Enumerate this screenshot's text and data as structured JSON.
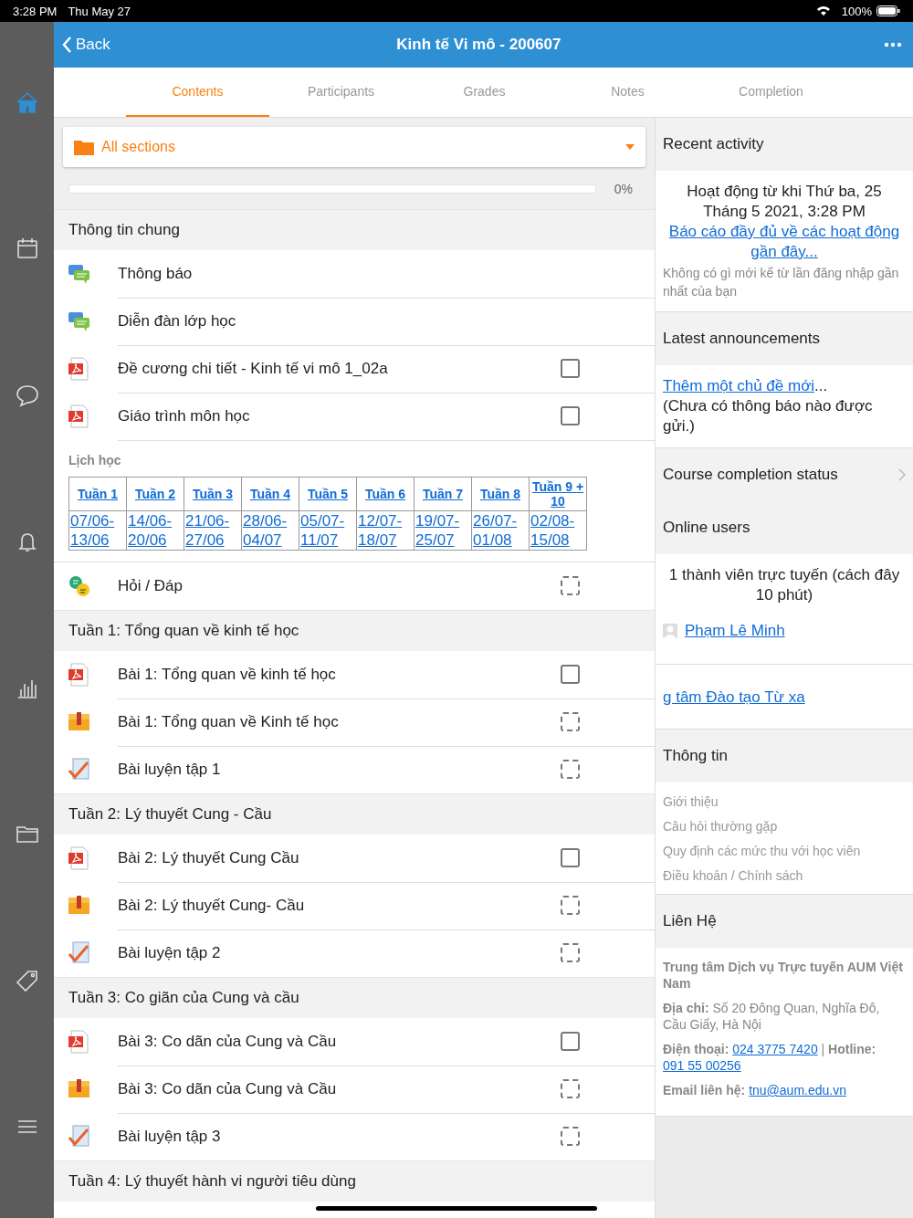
{
  "status_bar": {
    "time": "3:28 PM",
    "date": "Thu May 27",
    "battery": "100%"
  },
  "rail": [
    {
      "selected": true
    },
    {
      "selected": false
    },
    {
      "selected": false
    },
    {
      "selected": false
    },
    {
      "selected": false
    },
    {
      "selected": false
    },
    {
      "selected": false
    },
    {
      "selected": false
    }
  ],
  "header": {
    "back": "Back",
    "title": "Kinh tế Vi mô - 200607"
  },
  "tabs": [
    {
      "label": "Contents",
      "selected": true
    },
    {
      "label": "Participants",
      "selected": false
    },
    {
      "label": "Grades",
      "selected": false
    },
    {
      "label": "Notes",
      "selected": false
    },
    {
      "label": "Completion",
      "selected": false
    }
  ],
  "section_select": {
    "value": "All sections"
  },
  "progress": {
    "level": 0,
    "reading": "0%"
  },
  "sections": [
    {
      "title": "Thông tin chung",
      "items": [
        {
          "kind": "forum",
          "name": "Thông báo"
        },
        {
          "kind": "forum",
          "name": "Diễn đàn lớp học"
        },
        {
          "kind": "pdf",
          "name": "Đề cương chi tiết - Kinh tế vi mô 1_02a",
          "auto_tracked": false,
          "checked": false
        },
        {
          "kind": "pdf",
          "name": "Giáo trình môn học",
          "auto_tracked": false,
          "checked": false
        },
        {
          "kind": "schedule",
          "label": "Lịch học",
          "weeks": [
            {
              "week": "Tuần 1",
              "dates": "07/06-13/06"
            },
            {
              "week": "Tuần 2",
              "dates": "14/06-20/06"
            },
            {
              "week": "Tuần 3",
              "dates": "21/06-27/06"
            },
            {
              "week": "Tuần 4",
              "dates": "28/06-04/07"
            },
            {
              "week": "Tuần 5",
              "dates": "05/07-11/07"
            },
            {
              "week": "Tuần 6",
              "dates": "12/07-18/07"
            },
            {
              "week": "Tuần 7",
              "dates": "19/07-25/07"
            },
            {
              "week": "Tuần 8",
              "dates": "26/07-01/08"
            },
            {
              "week": "Tuần 9 + 10",
              "dates": "02/08-15/08"
            }
          ]
        },
        {
          "kind": "qa",
          "name": "Hỏi / Đáp",
          "auto_tracked": true,
          "checked": false
        }
      ]
    },
    {
      "title": "Tuần 1: Tổng quan về kinh tế học",
      "items": [
        {
          "kind": "pdf",
          "name": "Bài 1: Tổng quan về kinh tế học",
          "auto_tracked": false,
          "checked": false
        },
        {
          "kind": "package",
          "name": "Bài 1: Tổng quan về Kinh tế học",
          "auto_tracked": true,
          "checked": false
        },
        {
          "kind": "quiz",
          "name": "Bài luyện tập 1",
          "auto_tracked": true,
          "checked": false
        }
      ]
    },
    {
      "title": "Tuần 2: Lý thuyết Cung - Cầu",
      "items": [
        {
          "kind": "pdf",
          "name": "Bài 2: Lý thuyết Cung Cầu",
          "auto_tracked": false,
          "checked": false
        },
        {
          "kind": "package",
          "name": "Bài 2: Lý thuyết Cung- Cầu",
          "auto_tracked": true,
          "checked": false
        },
        {
          "kind": "quiz",
          "name": "Bài luyện tập 2",
          "auto_tracked": true,
          "checked": false
        }
      ]
    },
    {
      "title": "Tuần 3: Co giãn của Cung và cầu",
      "items": [
        {
          "kind": "pdf",
          "name": "Bài 3: Co dãn của Cung và Cầu",
          "auto_tracked": false,
          "checked": false
        },
        {
          "kind": "package",
          "name": "Bài 3: Co dãn của Cung và Cầu",
          "auto_tracked": true,
          "checked": false
        },
        {
          "kind": "quiz",
          "name": "Bài luyện tập 3",
          "auto_tracked": true,
          "checked": false
        }
      ]
    },
    {
      "title": "Tuần 4: Lý thuyết hành vi người tiêu dùng"
    }
  ],
  "side": {
    "recent": {
      "title": "Recent activity",
      "since": "Hoạt động từ khi Thứ ba, 25 Tháng 5 2021, 3:28 PM",
      "link": "Báo cáo đầy đủ về các hoạt động gần đây...",
      "note": "Không có gì mới kể từ lần đăng nhập gần nhất của bạn"
    },
    "announcements": {
      "title": "Latest announcements",
      "link": "Thêm một chủ đề mới",
      "ellipsis": "...",
      "note": "(Chưa có thông báo nào được gửi.)"
    },
    "completion": {
      "title": "Course completion status"
    },
    "online": {
      "title": "Online users",
      "summary": "1 thành viên trực tuyến (cách đây 10 phút)",
      "user": "Phạm Lê Minh"
    },
    "html": {
      "link": "g tâm Đào tạo Từ xa"
    },
    "info": {
      "title": "Thông tin",
      "links": [
        "Giới thiệu",
        "Câu hỏi thường gặp",
        "Quy định các mức thu với học viên",
        "Điều khoản / Chính sách"
      ]
    },
    "contact": {
      "title": "Liên Hệ",
      "org": "Trung tâm Dịch vụ Trực tuyến AUM Việt Nam",
      "address": "**Địa chỉ:** Số 20 Đông Quan, Nghĩa Đô, Cầu Giấy, Hà Nội",
      "phone_label": "Điện thoại:",
      "phone": "024 3775 7420",
      "separator": "|",
      "hotline_label": "Hotline:",
      "hotline": "091 55 00256",
      "email_label": "Email liên hệ:",
      "email": "tnu@aum.edu.vn"
    }
  }
}
